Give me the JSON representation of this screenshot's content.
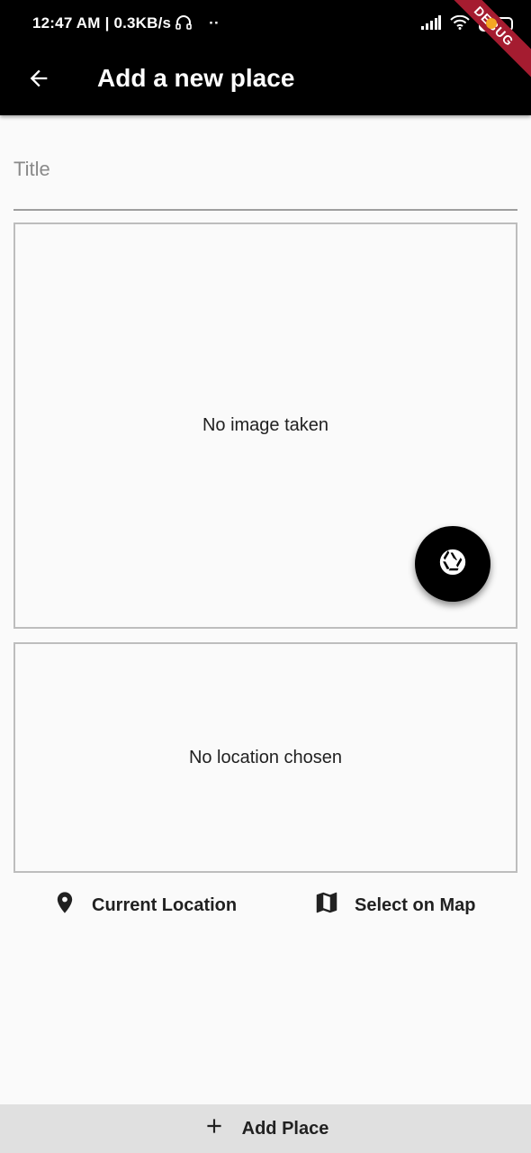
{
  "status": {
    "time": "12:47 AM",
    "speed": "0.3KB/s",
    "battery": "29"
  },
  "debug_banner": "DEBUG",
  "app_bar": {
    "title": "Add a new place"
  },
  "form": {
    "title_placeholder": "Title",
    "title_value": ""
  },
  "image_preview": {
    "empty_text": "No image taken"
  },
  "location_preview": {
    "empty_text": "No location chosen"
  },
  "actions": {
    "current_location": "Current Location",
    "select_on_map": "Select on Map",
    "add_place": "Add Place"
  },
  "icons": {
    "back": "arrow-left-icon",
    "camera": "camera-aperture-icon",
    "location": "location-pin-icon",
    "map": "map-icon",
    "add": "plus-icon"
  },
  "colors": {
    "app_bar": "#000000",
    "background": "#fafafa",
    "add_button_bg": "#e0e0e0",
    "debug_banner": "#a51c30"
  }
}
